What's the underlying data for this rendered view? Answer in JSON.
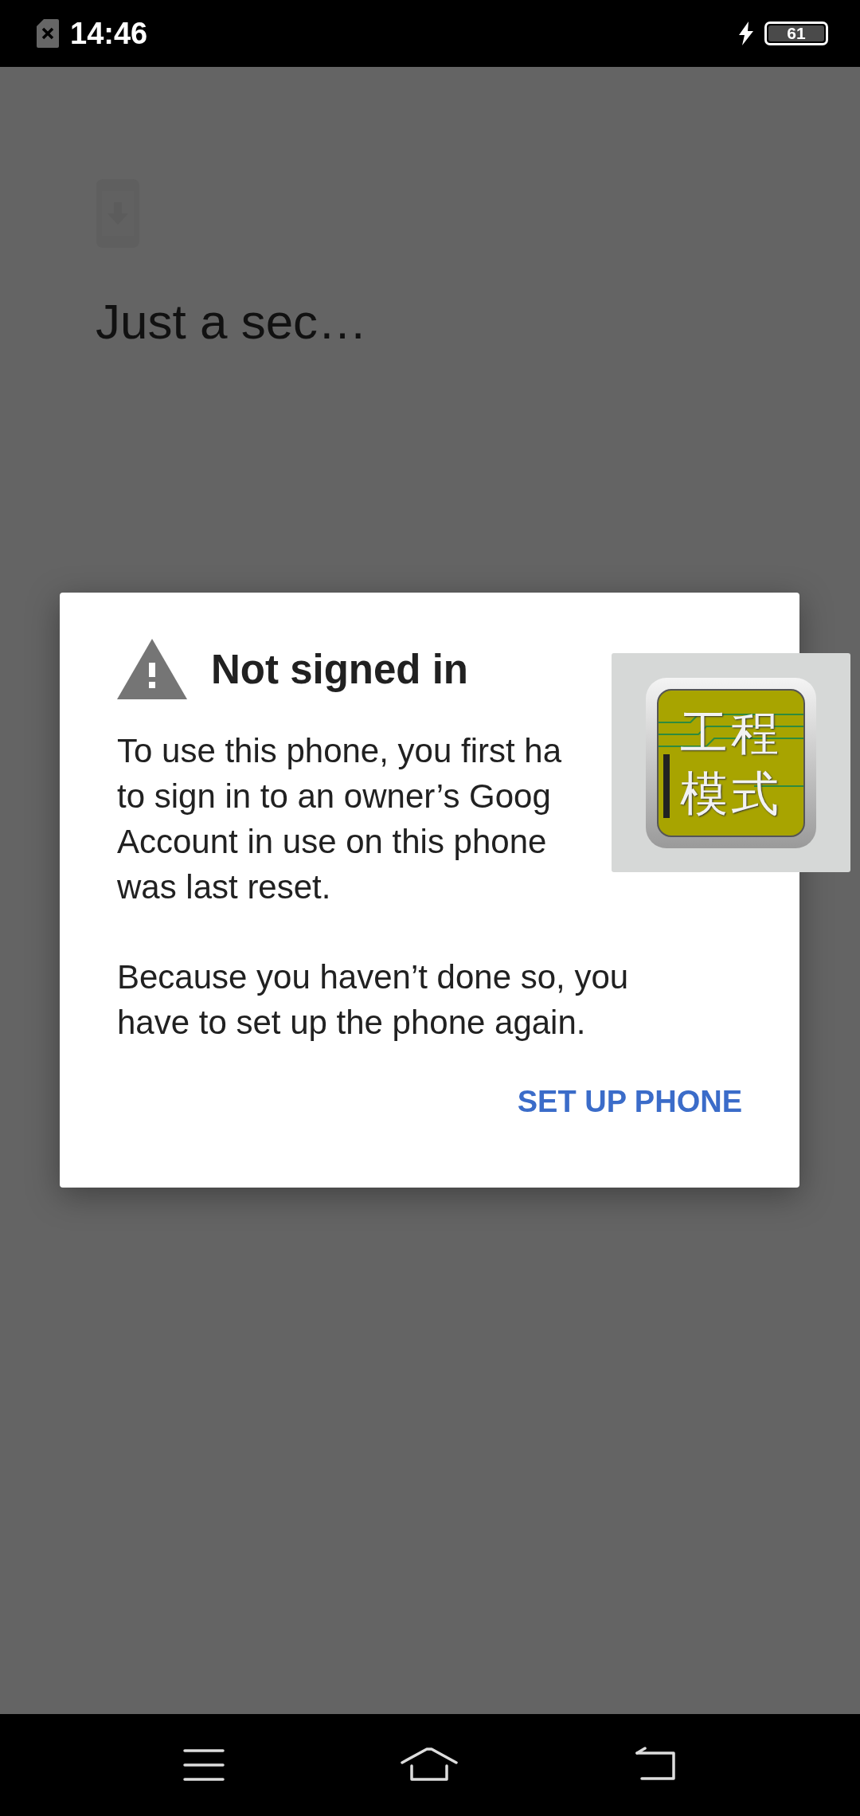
{
  "status_bar": {
    "time": "14:46",
    "battery": "61"
  },
  "screen": {
    "title": "Just a sec…"
  },
  "dialog": {
    "title": "Not signed in",
    "paragraphs": [
      [
        "To use this phone, you first ha",
        "to sign in to an owner’s Goog",
        "Account in use on this phone",
        "was last reset."
      ],
      [
        "Because you haven’t done so, you",
        "have to set up the phone again."
      ]
    ],
    "button": "SET UP PHONE"
  },
  "floating_button": {
    "label_lines": [
      "工程",
      "模式"
    ]
  }
}
